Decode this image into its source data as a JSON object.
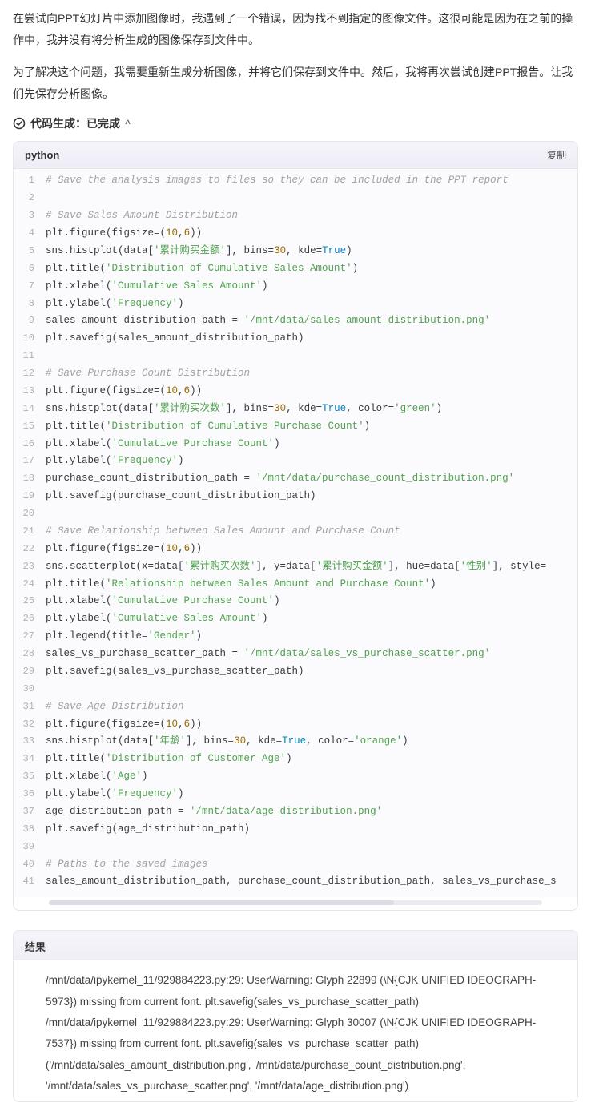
{
  "paragraphs": {
    "p1": "在尝试向PPT幻灯片中添加图像时，我遇到了一个错误，因为找不到指定的图像文件。这很可能是因为在之前的操作中，我并没有将分析生成的图像保存到文件中。",
    "p2": "为了解决这个问题，我需要重新生成分析图像，并将它们保存到文件中。然后，我将再次尝试创建PPT报告。让我们先保存分析图像。"
  },
  "status": {
    "label": "代码生成：已完成",
    "chevron": "^"
  },
  "codeBlock": {
    "language": "python",
    "copyLabel": "复制",
    "lines": [
      [
        {
          "t": "comment",
          "v": "# Save the analysis images to files so they can be included in the PPT report"
        }
      ],
      [],
      [
        {
          "t": "comment",
          "v": "# Save Sales Amount Distribution"
        }
      ],
      [
        {
          "t": "plain",
          "v": "plt.figure(figsize=("
        },
        {
          "t": "num",
          "v": "10"
        },
        {
          "t": "plain",
          "v": ","
        },
        {
          "t": "num",
          "v": "6"
        },
        {
          "t": "plain",
          "v": "))"
        }
      ],
      [
        {
          "t": "plain",
          "v": "sns.histplot(data["
        },
        {
          "t": "str",
          "v": "'累计购买金额'"
        },
        {
          "t": "plain",
          "v": "], bins="
        },
        {
          "t": "num",
          "v": "30"
        },
        {
          "t": "plain",
          "v": ", kde="
        },
        {
          "t": "bool",
          "v": "True"
        },
        {
          "t": "plain",
          "v": ")"
        }
      ],
      [
        {
          "t": "plain",
          "v": "plt.title("
        },
        {
          "t": "str",
          "v": "'Distribution of Cumulative Sales Amount'"
        },
        {
          "t": "plain",
          "v": ")"
        }
      ],
      [
        {
          "t": "plain",
          "v": "plt.xlabel("
        },
        {
          "t": "str",
          "v": "'Cumulative Sales Amount'"
        },
        {
          "t": "plain",
          "v": ")"
        }
      ],
      [
        {
          "t": "plain",
          "v": "plt.ylabel("
        },
        {
          "t": "str",
          "v": "'Frequency'"
        },
        {
          "t": "plain",
          "v": ")"
        }
      ],
      [
        {
          "t": "plain",
          "v": "sales_amount_distribution_path = "
        },
        {
          "t": "str",
          "v": "'/mnt/data/sales_amount_distribution.png'"
        }
      ],
      [
        {
          "t": "plain",
          "v": "plt.savefig(sales_amount_distribution_path)"
        }
      ],
      [],
      [
        {
          "t": "comment",
          "v": "# Save Purchase Count Distribution"
        }
      ],
      [
        {
          "t": "plain",
          "v": "plt.figure(figsize=("
        },
        {
          "t": "num",
          "v": "10"
        },
        {
          "t": "plain",
          "v": ","
        },
        {
          "t": "num",
          "v": "6"
        },
        {
          "t": "plain",
          "v": "))"
        }
      ],
      [
        {
          "t": "plain",
          "v": "sns.histplot(data["
        },
        {
          "t": "str",
          "v": "'累计购买次数'"
        },
        {
          "t": "plain",
          "v": "], bins="
        },
        {
          "t": "num",
          "v": "30"
        },
        {
          "t": "plain",
          "v": ", kde="
        },
        {
          "t": "bool",
          "v": "True"
        },
        {
          "t": "plain",
          "v": ", color="
        },
        {
          "t": "str",
          "v": "'green'"
        },
        {
          "t": "plain",
          "v": ")"
        }
      ],
      [
        {
          "t": "plain",
          "v": "plt.title("
        },
        {
          "t": "str",
          "v": "'Distribution of Cumulative Purchase Count'"
        },
        {
          "t": "plain",
          "v": ")"
        }
      ],
      [
        {
          "t": "plain",
          "v": "plt.xlabel("
        },
        {
          "t": "str",
          "v": "'Cumulative Purchase Count'"
        },
        {
          "t": "plain",
          "v": ")"
        }
      ],
      [
        {
          "t": "plain",
          "v": "plt.ylabel("
        },
        {
          "t": "str",
          "v": "'Frequency'"
        },
        {
          "t": "plain",
          "v": ")"
        }
      ],
      [
        {
          "t": "plain",
          "v": "purchase_count_distribution_path = "
        },
        {
          "t": "str",
          "v": "'/mnt/data/purchase_count_distribution.png'"
        }
      ],
      [
        {
          "t": "plain",
          "v": "plt.savefig(purchase_count_distribution_path)"
        }
      ],
      [],
      [
        {
          "t": "comment",
          "v": "# Save Relationship between Sales Amount and Purchase Count"
        }
      ],
      [
        {
          "t": "plain",
          "v": "plt.figure(figsize=("
        },
        {
          "t": "num",
          "v": "10"
        },
        {
          "t": "plain",
          "v": ","
        },
        {
          "t": "num",
          "v": "6"
        },
        {
          "t": "plain",
          "v": "))"
        }
      ],
      [
        {
          "t": "plain",
          "v": "sns.scatterplot(x=data["
        },
        {
          "t": "str",
          "v": "'累计购买次数'"
        },
        {
          "t": "plain",
          "v": "], y=data["
        },
        {
          "t": "str",
          "v": "'累计购买金额'"
        },
        {
          "t": "plain",
          "v": "], hue=data["
        },
        {
          "t": "str",
          "v": "'性别'"
        },
        {
          "t": "plain",
          "v": "], style="
        }
      ],
      [
        {
          "t": "plain",
          "v": "plt.title("
        },
        {
          "t": "str",
          "v": "'Relationship between Sales Amount and Purchase Count'"
        },
        {
          "t": "plain",
          "v": ")"
        }
      ],
      [
        {
          "t": "plain",
          "v": "plt.xlabel("
        },
        {
          "t": "str",
          "v": "'Cumulative Purchase Count'"
        },
        {
          "t": "plain",
          "v": ")"
        }
      ],
      [
        {
          "t": "plain",
          "v": "plt.ylabel("
        },
        {
          "t": "str",
          "v": "'Cumulative Sales Amount'"
        },
        {
          "t": "plain",
          "v": ")"
        }
      ],
      [
        {
          "t": "plain",
          "v": "plt.legend(title="
        },
        {
          "t": "str",
          "v": "'Gender'"
        },
        {
          "t": "plain",
          "v": ")"
        }
      ],
      [
        {
          "t": "plain",
          "v": "sales_vs_purchase_scatter_path = "
        },
        {
          "t": "str",
          "v": "'/mnt/data/sales_vs_purchase_scatter.png'"
        }
      ],
      [
        {
          "t": "plain",
          "v": "plt.savefig(sales_vs_purchase_scatter_path)"
        }
      ],
      [],
      [
        {
          "t": "comment",
          "v": "# Save Age Distribution"
        }
      ],
      [
        {
          "t": "plain",
          "v": "plt.figure(figsize=("
        },
        {
          "t": "num",
          "v": "10"
        },
        {
          "t": "plain",
          "v": ","
        },
        {
          "t": "num",
          "v": "6"
        },
        {
          "t": "plain",
          "v": "))"
        }
      ],
      [
        {
          "t": "plain",
          "v": "sns.histplot(data["
        },
        {
          "t": "str",
          "v": "'年龄'"
        },
        {
          "t": "plain",
          "v": "], bins="
        },
        {
          "t": "num",
          "v": "30"
        },
        {
          "t": "plain",
          "v": ", kde="
        },
        {
          "t": "bool",
          "v": "True"
        },
        {
          "t": "plain",
          "v": ", color="
        },
        {
          "t": "str",
          "v": "'orange'"
        },
        {
          "t": "plain",
          "v": ")"
        }
      ],
      [
        {
          "t": "plain",
          "v": "plt.title("
        },
        {
          "t": "str",
          "v": "'Distribution of Customer Age'"
        },
        {
          "t": "plain",
          "v": ")"
        }
      ],
      [
        {
          "t": "plain",
          "v": "plt.xlabel("
        },
        {
          "t": "str",
          "v": "'Age'"
        },
        {
          "t": "plain",
          "v": ")"
        }
      ],
      [
        {
          "t": "plain",
          "v": "plt.ylabel("
        },
        {
          "t": "str",
          "v": "'Frequency'"
        },
        {
          "t": "plain",
          "v": ")"
        }
      ],
      [
        {
          "t": "plain",
          "v": "age_distribution_path = "
        },
        {
          "t": "str",
          "v": "'/mnt/data/age_distribution.png'"
        }
      ],
      [
        {
          "t": "plain",
          "v": "plt.savefig(age_distribution_path)"
        }
      ],
      [],
      [
        {
          "t": "comment",
          "v": "# Paths to the saved images"
        }
      ],
      [
        {
          "t": "plain",
          "v": "sales_amount_distribution_path, purchase_count_distribution_path, sales_vs_purchase_s"
        }
      ]
    ]
  },
  "result": {
    "title": "结果",
    "lines": [
      "/mnt/data/ipykernel_11/929884223.py:29: UserWarning: Glyph 22899 (\\N{CJK UNIFIED IDEOGRAPH-5973}) missing from current font. plt.savefig(sales_vs_purchase_scatter_path)",
      "/mnt/data/ipykernel_11/929884223.py:29: UserWarning: Glyph 30007 (\\N{CJK UNIFIED IDEOGRAPH-7537}) missing from current font. plt.savefig(sales_vs_purchase_scatter_path)",
      "('/mnt/data/sales_amount_distribution.png', '/mnt/data/purchase_count_distribution.png', '/mnt/data/sales_vs_purchase_scatter.png', '/mnt/data/age_distribution.png')"
    ]
  }
}
